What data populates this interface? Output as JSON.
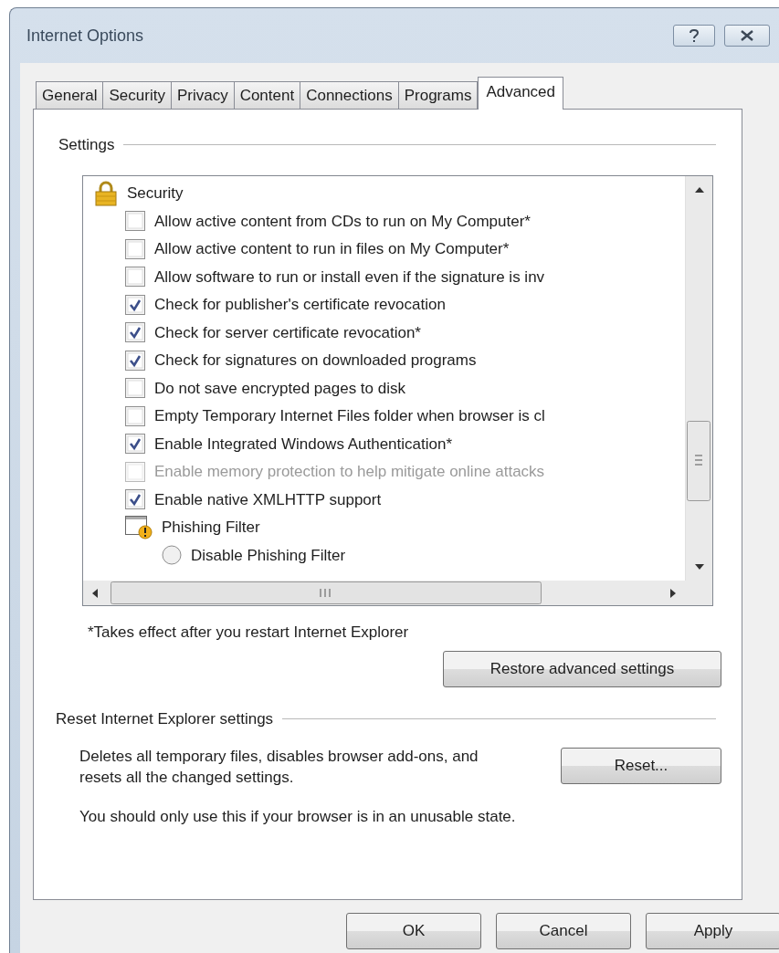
{
  "window": {
    "title": "Internet Options"
  },
  "tabs": [
    {
      "label": "General",
      "selected": false
    },
    {
      "label": "Security",
      "selected": false
    },
    {
      "label": "Privacy",
      "selected": false
    },
    {
      "label": "Content",
      "selected": false
    },
    {
      "label": "Connections",
      "selected": false
    },
    {
      "label": "Programs",
      "selected": false
    },
    {
      "label": "Advanced",
      "selected": true
    }
  ],
  "settings": {
    "legend": "Settings",
    "items": [
      {
        "kind": "lock-heading",
        "label": "Security"
      },
      {
        "kind": "checkbox",
        "label": "Allow active content from CDs to run on My Computer*",
        "checked": false,
        "disabled": false
      },
      {
        "kind": "checkbox",
        "label": "Allow active content to run in files on My Computer*",
        "checked": false,
        "disabled": false
      },
      {
        "kind": "checkbox",
        "label": "Allow software to run or install even if the signature is inv",
        "checked": false,
        "disabled": false
      },
      {
        "kind": "checkbox",
        "label": "Check for publisher's certificate revocation",
        "checked": true,
        "disabled": false
      },
      {
        "kind": "checkbox",
        "label": "Check for server certificate revocation*",
        "checked": true,
        "disabled": false
      },
      {
        "kind": "checkbox",
        "label": "Check for signatures on downloaded programs",
        "checked": true,
        "disabled": false
      },
      {
        "kind": "checkbox",
        "label": "Do not save encrypted pages to disk",
        "checked": false,
        "disabled": false
      },
      {
        "kind": "checkbox",
        "label": "Empty Temporary Internet Files folder when browser is cl",
        "checked": false,
        "disabled": false
      },
      {
        "kind": "checkbox",
        "label": "Enable Integrated Windows Authentication*",
        "checked": true,
        "disabled": false
      },
      {
        "kind": "checkbox",
        "label": "Enable memory protection to help mitigate online attacks",
        "checked": false,
        "disabled": true
      },
      {
        "kind": "checkbox",
        "label": "Enable native XMLHTTP support",
        "checked": true,
        "disabled": false
      },
      {
        "kind": "warning-heading",
        "label": "Phishing Filter"
      },
      {
        "kind": "radio",
        "label": "Disable Phishing Filter",
        "selected": false
      }
    ],
    "footnote": "*Takes effect after you restart Internet Explorer",
    "restore_button": "Restore advanced settings"
  },
  "reset": {
    "legend": "Reset Internet Explorer settings",
    "description": "Deletes all temporary files, disables browser add-ons, and resets all the changed settings.",
    "button": "Reset...",
    "note": "You should only use this if your browser is in an unusable state."
  },
  "buttons": [
    "OK",
    "Cancel",
    "Apply"
  ]
}
